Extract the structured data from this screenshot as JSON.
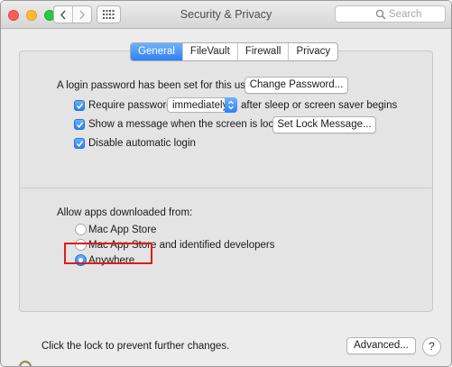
{
  "window": {
    "title": "Security & Privacy",
    "search_placeholder": "Search"
  },
  "tabs": [
    {
      "label": "General",
      "active": true
    },
    {
      "label": "FileVault",
      "active": false
    },
    {
      "label": "Firewall",
      "active": false
    },
    {
      "label": "Privacy",
      "active": false
    }
  ],
  "general": {
    "login_password_text": "A login password has been set for this user",
    "change_password_label": "Change Password...",
    "require_password": {
      "checked": true,
      "label": "Require password",
      "delay_value": "immediately",
      "suffix": "after sleep or screen saver begins"
    },
    "show_message": {
      "checked": true,
      "label": "Show a message when the screen is locked",
      "button_label": "Set Lock Message..."
    },
    "disable_auto_login": {
      "checked": true,
      "label": "Disable automatic login"
    },
    "allow_apps": {
      "heading": "Allow apps downloaded from:",
      "options": [
        {
          "label": "Mac App Store",
          "selected": false
        },
        {
          "label": "Mac App Store and identified developers",
          "selected": false
        },
        {
          "label": "Anywhere",
          "selected": true
        }
      ]
    }
  },
  "footer": {
    "lock_text": "Click the lock to prevent further changes.",
    "advanced_label": "Advanced...",
    "help_label": "?"
  },
  "colors": {
    "accent": "#2e80f2",
    "highlight": "#e01b1b"
  },
  "icons": [
    "chevron-left-icon",
    "chevron-right-icon",
    "grid-icon",
    "search-icon",
    "checkmark-icon",
    "up-down-arrows-icon",
    "lock-icon"
  ]
}
